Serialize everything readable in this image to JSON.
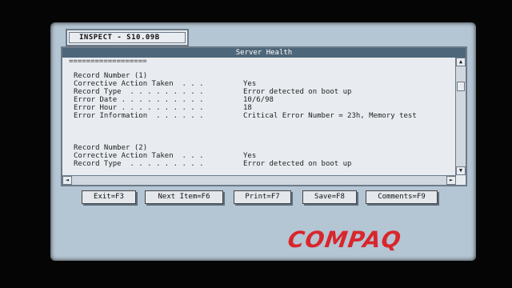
{
  "app_tab": {
    "label": "INSPECT - S10.09B"
  },
  "window": {
    "title": "Server Health",
    "separator": "=================="
  },
  "records": [
    {
      "header": "Record Number (1)",
      "fields": [
        {
          "label": "Corrective Action Taken  . . .",
          "value": "Yes"
        },
        {
          "label": "Record Type  . . . . . . . . .",
          "value": "Error detected on boot up"
        },
        {
          "label": "Error Date . . . . . . . . . .",
          "value": "10/6/98"
        },
        {
          "label": "Error Hour . . . . . . . . . .",
          "value": "18"
        },
        {
          "label": "Error Information  . . . . . .",
          "value": "Critical Error Number = 23h, Memory test"
        }
      ]
    },
    {
      "header": "Record Number (2)",
      "fields": [
        {
          "label": "Corrective Action Taken  . . .",
          "value": "Yes"
        },
        {
          "label": "Record Type  . . . . . . . . .",
          "value": "Error detected on boot up"
        }
      ]
    }
  ],
  "scroll": {
    "up": "▲",
    "down": "▼",
    "left": "◄",
    "right": "►"
  },
  "buttons": {
    "exit": "Exit=F3",
    "next_item": "Next Item=F6",
    "print": "Print=F7",
    "save": "Save=F8",
    "comments": "Comments=F9"
  },
  "logo": {
    "text": "COMPAQ"
  },
  "colors": {
    "screen_bg": "#b4c5d3",
    "titlebar": "#4e6679",
    "logo": "#d8262c"
  }
}
